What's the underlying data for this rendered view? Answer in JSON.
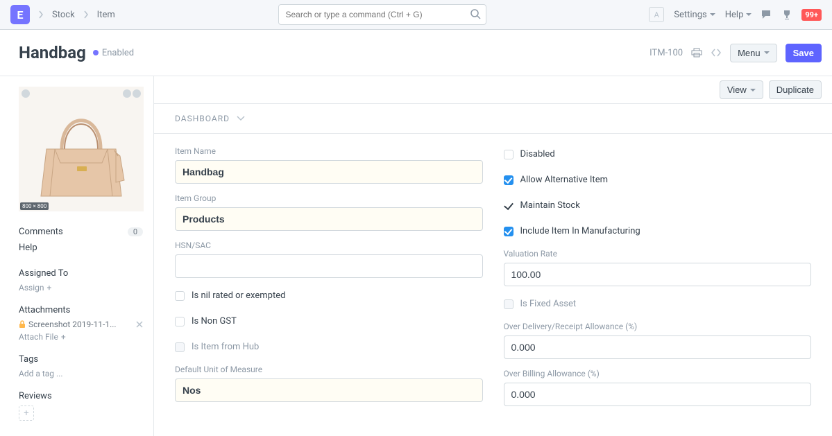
{
  "nav": {
    "logo_letter": "E",
    "crumbs": [
      "Stock",
      "Item"
    ],
    "search_placeholder": "Search or type a command (Ctrl + G)",
    "avatar_letter": "A",
    "settings_label": "Settings",
    "help_label": "Help",
    "notif_badge": "99+"
  },
  "page": {
    "title": "Handbag",
    "status_label": "Enabled"
  },
  "actions": {
    "item_code": "ITM-100",
    "menu_label": "Menu",
    "save_label": "Save",
    "view_label": "View",
    "duplicate_label": "Duplicate"
  },
  "sidebar": {
    "image_size_label": "800 × 800",
    "comments_label": "Comments",
    "comments_count": "0",
    "help_label": "Help",
    "assigned_to_label": "Assigned To",
    "assign_label": "Assign",
    "attachments_label": "Attachments",
    "attachment_name": "Screenshot 2019-11-1...",
    "attach_file_label": "Attach File",
    "tags_label": "Tags",
    "add_tag_label": "Add a tag ...",
    "reviews_label": "Reviews"
  },
  "form": {
    "section_title": "DASHBOARD",
    "left": {
      "item_name": {
        "label": "Item Name",
        "value": "Handbag"
      },
      "item_group": {
        "label": "Item Group",
        "value": "Products"
      },
      "hsn_sac": {
        "label": "HSN/SAC",
        "value": ""
      },
      "is_nil_rated": {
        "label": "Is nil rated or exempted",
        "checked": false
      },
      "is_non_gst": {
        "label": "Is Non GST",
        "checked": false
      },
      "is_item_from_hub": {
        "label": "Is Item from Hub",
        "checked": false
      },
      "default_uom": {
        "label": "Default Unit of Measure",
        "value": "Nos"
      }
    },
    "right": {
      "disabled": {
        "label": "Disabled",
        "checked": false
      },
      "allow_alternative": {
        "label": "Allow Alternative Item",
        "checked": true
      },
      "maintain_stock": {
        "label": "Maintain Stock",
        "checked": true,
        "style": "plain"
      },
      "include_mfg": {
        "label": "Include Item In Manufacturing",
        "checked": true
      },
      "valuation_rate": {
        "label": "Valuation Rate",
        "value": "100.00"
      },
      "is_fixed_asset": {
        "label": "Is Fixed Asset",
        "checked": false,
        "disabled": true
      },
      "over_delivery": {
        "label": "Over Delivery/Receipt Allowance (%)",
        "value": "0.000"
      },
      "over_billing": {
        "label": "Over Billing Allowance (%)",
        "value": "0.000"
      }
    }
  }
}
